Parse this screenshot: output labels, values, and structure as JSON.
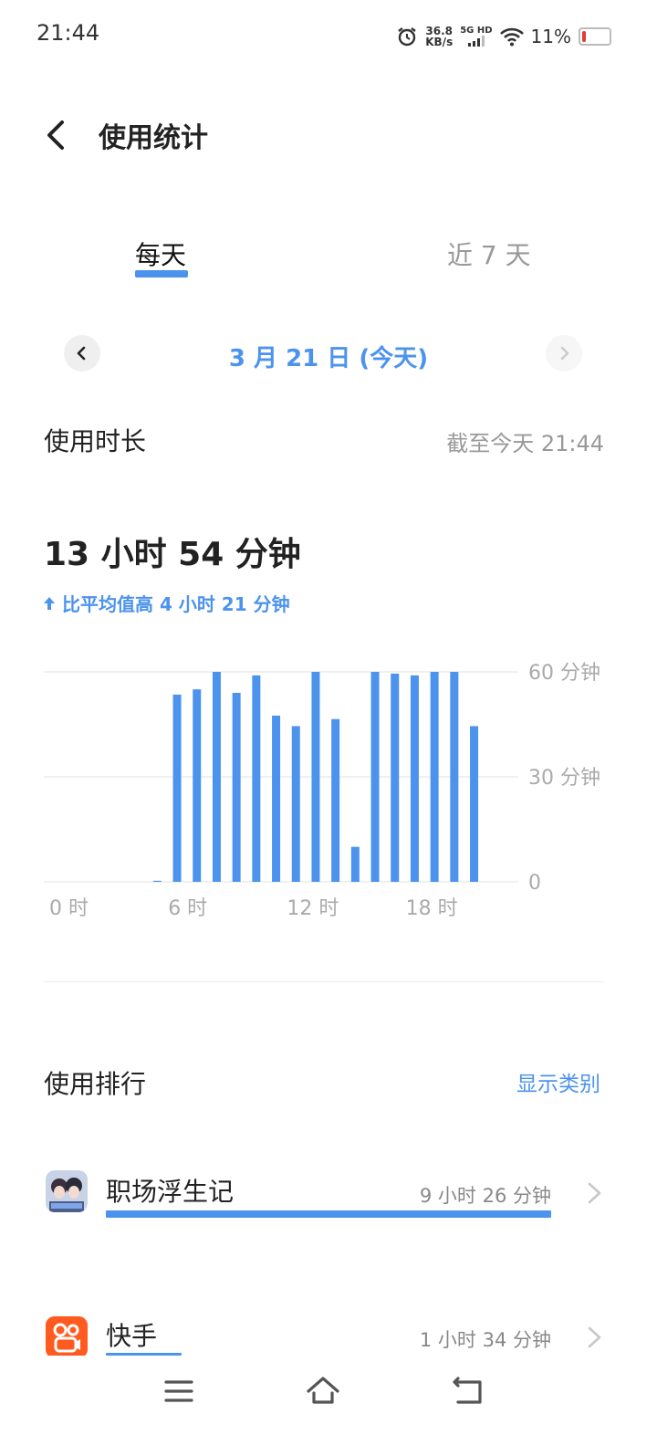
{
  "status": {
    "time": "21:44",
    "net_speed_value": "36.8",
    "net_speed_unit": "KB/s",
    "net_type": "5G HD",
    "battery_percent": "11%",
    "battery_level": 0.11,
    "battery_color": "#e53935"
  },
  "header": {
    "title": "使用统计",
    "back_icon": "chevron-left-icon"
  },
  "tabs": [
    {
      "label": "每天",
      "active": true
    },
    {
      "label": "近 7 天",
      "active": false
    }
  ],
  "date_nav": {
    "label": "3 月 21 日 (今天)"
  },
  "usage": {
    "title": "使用时长",
    "as_of": "截至今天 21:44",
    "total": "13 小时 54 分钟",
    "compare": "比平均值高 4 小时 21 分钟"
  },
  "chart_data": {
    "type": "bar",
    "x": [
      0,
      1,
      2,
      3,
      4,
      5,
      6,
      7,
      8,
      9,
      10,
      11,
      12,
      13,
      14,
      15,
      16,
      17,
      18,
      19,
      20,
      21,
      22,
      23
    ],
    "values": [
      0,
      0,
      0,
      0,
      0,
      0.3,
      53.5,
      55,
      60,
      54,
      59,
      47.5,
      44.5,
      60,
      46.5,
      10,
      60,
      59.5,
      59,
      60,
      60,
      44.5,
      0,
      0
    ],
    "x_tick_labels": [
      "0 时",
      "6 时",
      "12 时",
      "18 时"
    ],
    "y_tick_labels": [
      "60 分钟",
      "30 分钟",
      "0"
    ],
    "ylim": [
      0,
      60
    ],
    "bar_color": "#4c93ee",
    "grid": true
  },
  "ranking": {
    "title": "使用排行",
    "show_category": "显示类别",
    "apps": [
      {
        "name": "职场浮生记",
        "time": "9 小时 26 分钟",
        "fraction": 1.0
      },
      {
        "name": "快手",
        "time": "1 小时 34 分钟",
        "fraction": 0.17
      }
    ]
  },
  "colors": {
    "accent": "#4c93ee",
    "kuaishou": "#ff5a1f"
  }
}
